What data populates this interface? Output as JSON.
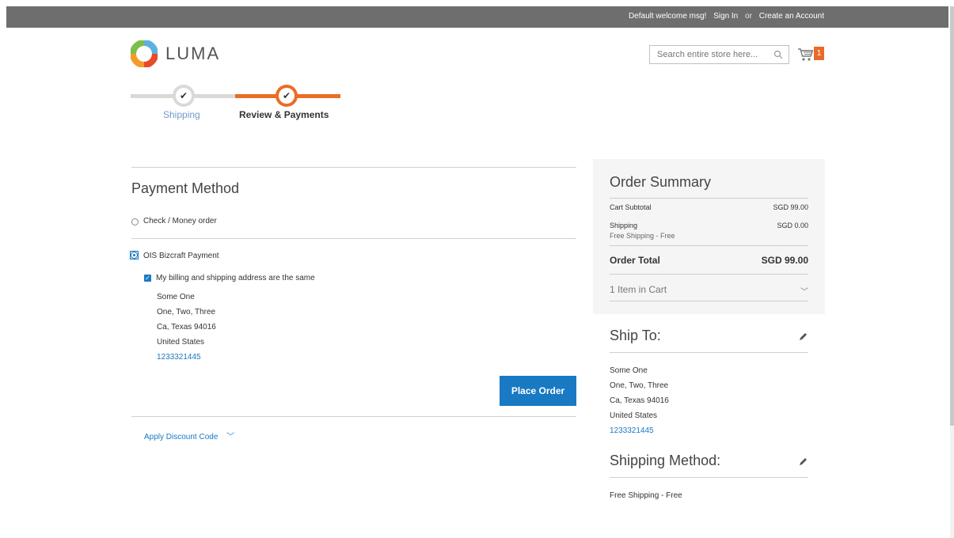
{
  "header": {
    "welcome": "Default welcome msg!",
    "sign_in": "Sign In",
    "or": "or",
    "create_account": "Create an Account"
  },
  "logo": {
    "text": "LUMA"
  },
  "search": {
    "placeholder": "Search entire store here..."
  },
  "cart": {
    "count": "1"
  },
  "progress": {
    "steps": [
      {
        "label": "Shipping",
        "state": "completed"
      },
      {
        "label": "Review & Payments",
        "state": "active"
      }
    ]
  },
  "payment": {
    "title": "Payment Method",
    "methods": [
      {
        "label": "Check / Money order",
        "selected": false
      },
      {
        "label": "OIS Bizcraft Payment",
        "selected": true
      }
    ],
    "same_address_label": "My billing and shipping address are the same",
    "address": {
      "name": "Some One",
      "street": "One, Two, Three",
      "city_line": "Ca, Texas 94016",
      "country": "United States",
      "phone": "1233321445"
    },
    "place_order": "Place Order",
    "discount_label": "Apply Discount Code"
  },
  "summary": {
    "title": "Order Summary",
    "cart_subtotal_label": "Cart Subtotal",
    "cart_subtotal_value": "SGD 99.00",
    "shipping_label": "Shipping",
    "shipping_sub": "Free Shipping - Free",
    "shipping_value": "SGD 0.00",
    "order_total_label": "Order Total",
    "order_total_value": "SGD 99.00",
    "items_in_cart": "1 Item in Cart"
  },
  "ship_to": {
    "title": "Ship To:",
    "name": "Some One",
    "street": "One, Two, Three",
    "city_line": "Ca, Texas 94016",
    "country": "United States",
    "phone": "1233321445"
  },
  "shipping_method": {
    "title": "Shipping Method:",
    "value": "Free Shipping - Free"
  },
  "colors": {
    "accent_orange": "#ed6b24",
    "link_blue": "#1979c3",
    "topbar": "#6e6e6e"
  }
}
